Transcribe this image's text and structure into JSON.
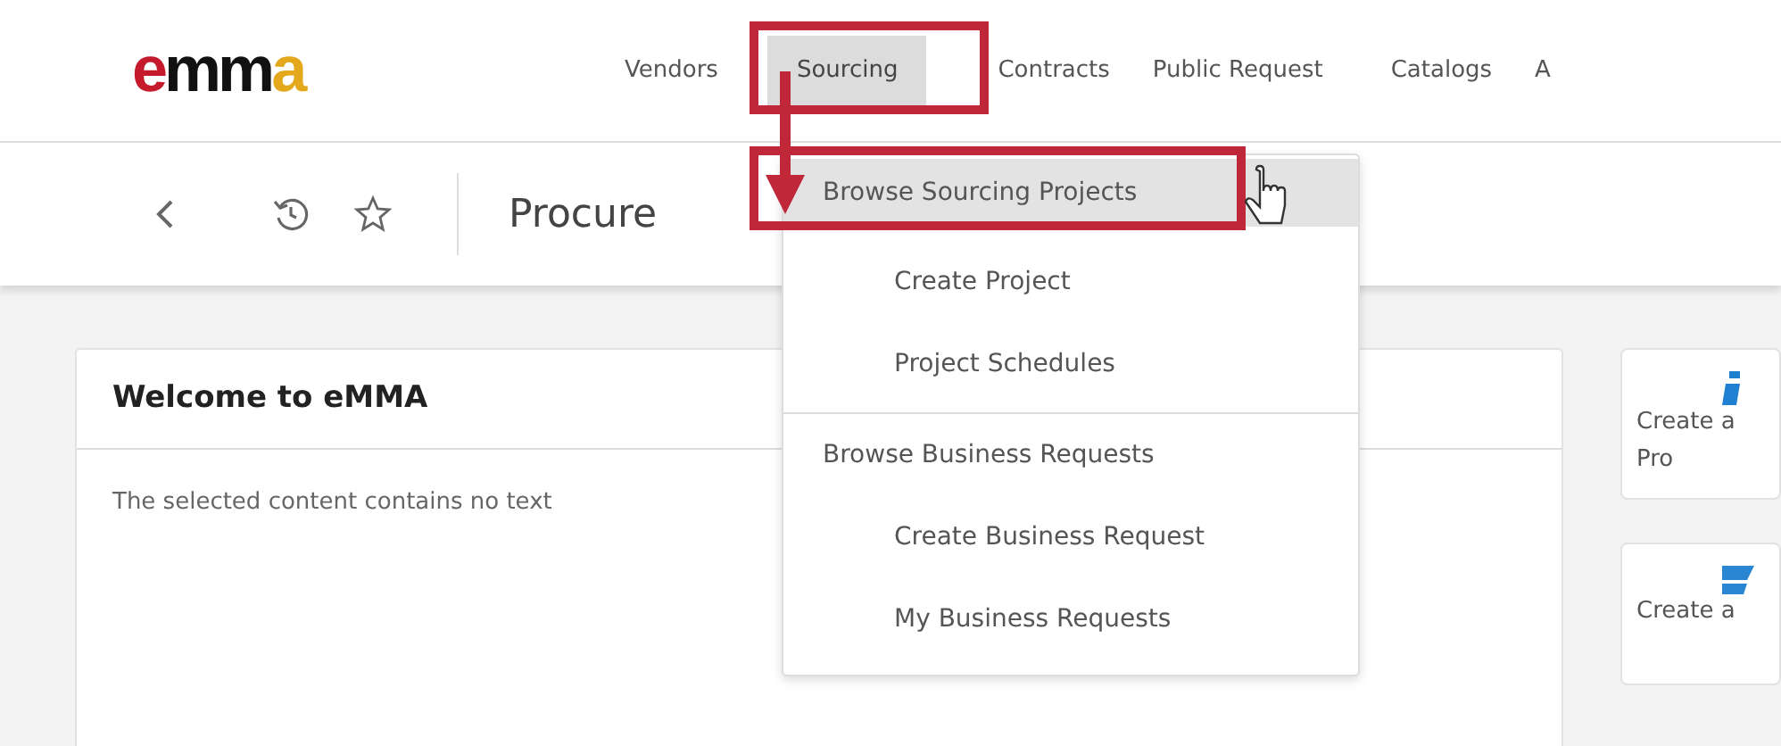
{
  "logo": {
    "text": "emma"
  },
  "nav": [
    {
      "label": "Vendors",
      "selected": false
    },
    {
      "label": "Sourcing",
      "selected": true
    },
    {
      "label": "Contracts",
      "selected": false
    },
    {
      "label": "Public Request",
      "selected": false
    },
    {
      "label": "Catalogs",
      "selected": false
    },
    {
      "label": "A",
      "selected": false
    }
  ],
  "toolbar": {
    "page_title": "Procure"
  },
  "dropdown": [
    {
      "label": "Browse Sourcing Projects",
      "selected": true,
      "children": [
        {
          "label": "Create Project",
          "selected": false
        },
        {
          "label": "Project Schedules",
          "selected": false
        }
      ]
    },
    {
      "label": "Browse Business Requests",
      "selected": false,
      "children": [
        {
          "label": "Create Business Request",
          "selected": false
        },
        {
          "label": "My Business Requests",
          "selected": false
        }
      ]
    }
  ],
  "welcome_card": {
    "title": "Welcome to eMMA",
    "body": "The selected content contains no text"
  },
  "side_cards": [
    {
      "lines": [
        "Create a",
        "Pro"
      ]
    },
    {
      "lines": [
        "Create a"
      ]
    }
  ]
}
